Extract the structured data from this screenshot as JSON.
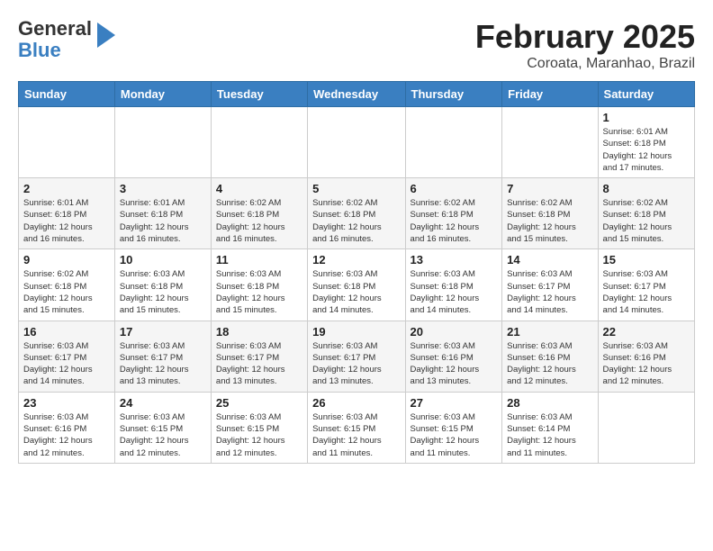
{
  "logo": {
    "line1": "General",
    "line2": "Blue"
  },
  "title": "February 2025",
  "subtitle": "Coroata, Maranhao, Brazil",
  "weekdays": [
    "Sunday",
    "Monday",
    "Tuesday",
    "Wednesday",
    "Thursday",
    "Friday",
    "Saturday"
  ],
  "weeks": [
    [
      {
        "day": "",
        "info": ""
      },
      {
        "day": "",
        "info": ""
      },
      {
        "day": "",
        "info": ""
      },
      {
        "day": "",
        "info": ""
      },
      {
        "day": "",
        "info": ""
      },
      {
        "day": "",
        "info": ""
      },
      {
        "day": "1",
        "info": "Sunrise: 6:01 AM\nSunset: 6:18 PM\nDaylight: 12 hours\nand 17 minutes."
      }
    ],
    [
      {
        "day": "2",
        "info": "Sunrise: 6:01 AM\nSunset: 6:18 PM\nDaylight: 12 hours\nand 16 minutes."
      },
      {
        "day": "3",
        "info": "Sunrise: 6:01 AM\nSunset: 6:18 PM\nDaylight: 12 hours\nand 16 minutes."
      },
      {
        "day": "4",
        "info": "Sunrise: 6:02 AM\nSunset: 6:18 PM\nDaylight: 12 hours\nand 16 minutes."
      },
      {
        "day": "5",
        "info": "Sunrise: 6:02 AM\nSunset: 6:18 PM\nDaylight: 12 hours\nand 16 minutes."
      },
      {
        "day": "6",
        "info": "Sunrise: 6:02 AM\nSunset: 6:18 PM\nDaylight: 12 hours\nand 16 minutes."
      },
      {
        "day": "7",
        "info": "Sunrise: 6:02 AM\nSunset: 6:18 PM\nDaylight: 12 hours\nand 15 minutes."
      },
      {
        "day": "8",
        "info": "Sunrise: 6:02 AM\nSunset: 6:18 PM\nDaylight: 12 hours\nand 15 minutes."
      }
    ],
    [
      {
        "day": "9",
        "info": "Sunrise: 6:02 AM\nSunset: 6:18 PM\nDaylight: 12 hours\nand 15 minutes."
      },
      {
        "day": "10",
        "info": "Sunrise: 6:03 AM\nSunset: 6:18 PM\nDaylight: 12 hours\nand 15 minutes."
      },
      {
        "day": "11",
        "info": "Sunrise: 6:03 AM\nSunset: 6:18 PM\nDaylight: 12 hours\nand 15 minutes."
      },
      {
        "day": "12",
        "info": "Sunrise: 6:03 AM\nSunset: 6:18 PM\nDaylight: 12 hours\nand 14 minutes."
      },
      {
        "day": "13",
        "info": "Sunrise: 6:03 AM\nSunset: 6:18 PM\nDaylight: 12 hours\nand 14 minutes."
      },
      {
        "day": "14",
        "info": "Sunrise: 6:03 AM\nSunset: 6:17 PM\nDaylight: 12 hours\nand 14 minutes."
      },
      {
        "day": "15",
        "info": "Sunrise: 6:03 AM\nSunset: 6:17 PM\nDaylight: 12 hours\nand 14 minutes."
      }
    ],
    [
      {
        "day": "16",
        "info": "Sunrise: 6:03 AM\nSunset: 6:17 PM\nDaylight: 12 hours\nand 14 minutes."
      },
      {
        "day": "17",
        "info": "Sunrise: 6:03 AM\nSunset: 6:17 PM\nDaylight: 12 hours\nand 13 minutes."
      },
      {
        "day": "18",
        "info": "Sunrise: 6:03 AM\nSunset: 6:17 PM\nDaylight: 12 hours\nand 13 minutes."
      },
      {
        "day": "19",
        "info": "Sunrise: 6:03 AM\nSunset: 6:17 PM\nDaylight: 12 hours\nand 13 minutes."
      },
      {
        "day": "20",
        "info": "Sunrise: 6:03 AM\nSunset: 6:16 PM\nDaylight: 12 hours\nand 13 minutes."
      },
      {
        "day": "21",
        "info": "Sunrise: 6:03 AM\nSunset: 6:16 PM\nDaylight: 12 hours\nand 12 minutes."
      },
      {
        "day": "22",
        "info": "Sunrise: 6:03 AM\nSunset: 6:16 PM\nDaylight: 12 hours\nand 12 minutes."
      }
    ],
    [
      {
        "day": "23",
        "info": "Sunrise: 6:03 AM\nSunset: 6:16 PM\nDaylight: 12 hours\nand 12 minutes."
      },
      {
        "day": "24",
        "info": "Sunrise: 6:03 AM\nSunset: 6:15 PM\nDaylight: 12 hours\nand 12 minutes."
      },
      {
        "day": "25",
        "info": "Sunrise: 6:03 AM\nSunset: 6:15 PM\nDaylight: 12 hours\nand 12 minutes."
      },
      {
        "day": "26",
        "info": "Sunrise: 6:03 AM\nSunset: 6:15 PM\nDaylight: 12 hours\nand 11 minutes."
      },
      {
        "day": "27",
        "info": "Sunrise: 6:03 AM\nSunset: 6:15 PM\nDaylight: 12 hours\nand 11 minutes."
      },
      {
        "day": "28",
        "info": "Sunrise: 6:03 AM\nSunset: 6:14 PM\nDaylight: 12 hours\nand 11 minutes."
      },
      {
        "day": "",
        "info": ""
      }
    ]
  ]
}
